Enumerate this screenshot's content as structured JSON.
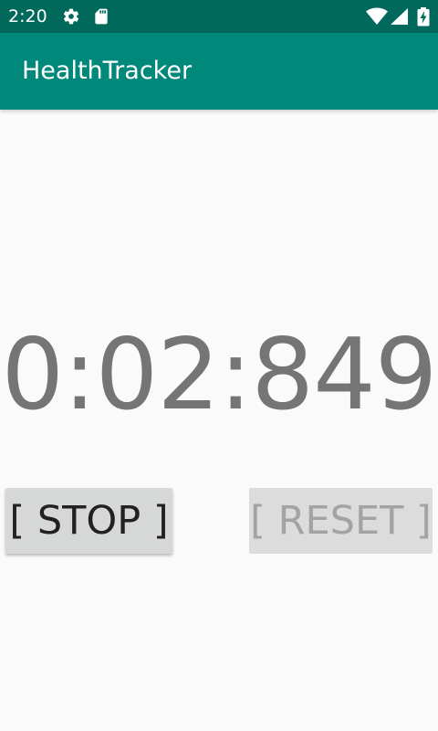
{
  "status_bar": {
    "time": "2:20",
    "icons": [
      "gear-icon",
      "sd-card-icon",
      "wifi-icon",
      "signal-icon",
      "battery-charging-icon"
    ],
    "background_color": "#00695c"
  },
  "app_bar": {
    "title": "HealthTracker",
    "background_color": "#00897b"
  },
  "timer": {
    "value": "0:02:849"
  },
  "buttons": {
    "stop_label": "[ STOP ]",
    "reset_label": "[ RESET ]",
    "reset_enabled": false
  }
}
